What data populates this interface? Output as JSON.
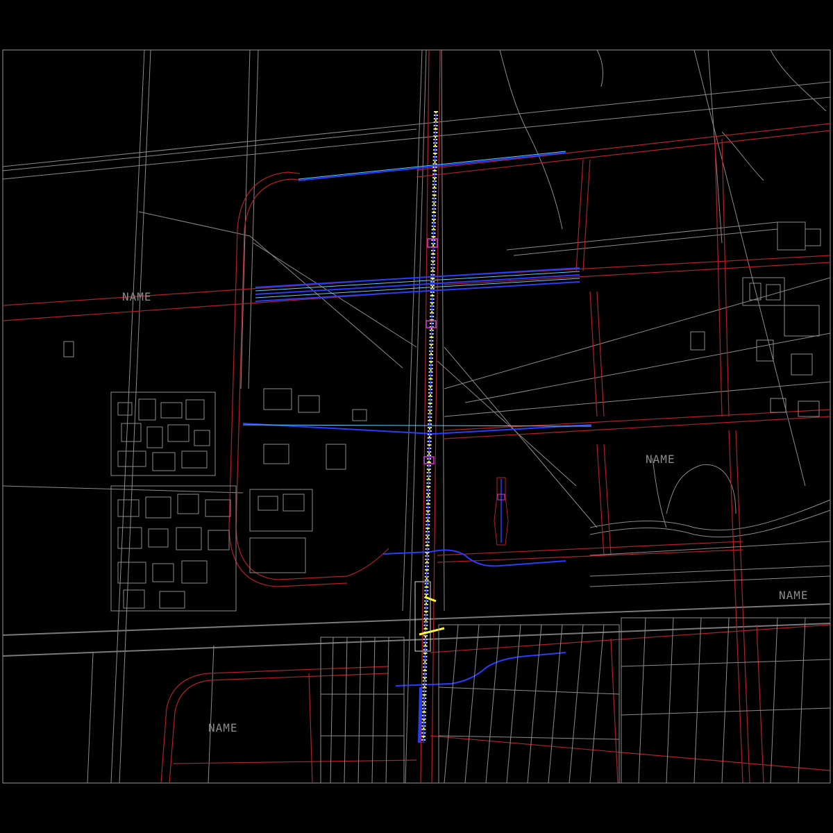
{
  "map": {
    "labels": [
      {
        "id": "label-northwest",
        "text": "NAME"
      },
      {
        "id": "label-east",
        "text": "NAME"
      },
      {
        "id": "label-southeast",
        "text": "NAME"
      },
      {
        "id": "label-southwest",
        "text": "NAME"
      }
    ],
    "colors": {
      "background": "#000000",
      "frame": "#9a9a9a",
      "terrain_lines": "#8c8c8c",
      "planned_roads": "#b3212a",
      "pipelines": "#2a3cff",
      "centerline_markers": "#ffff33",
      "accent": "#d23cd2"
    }
  }
}
